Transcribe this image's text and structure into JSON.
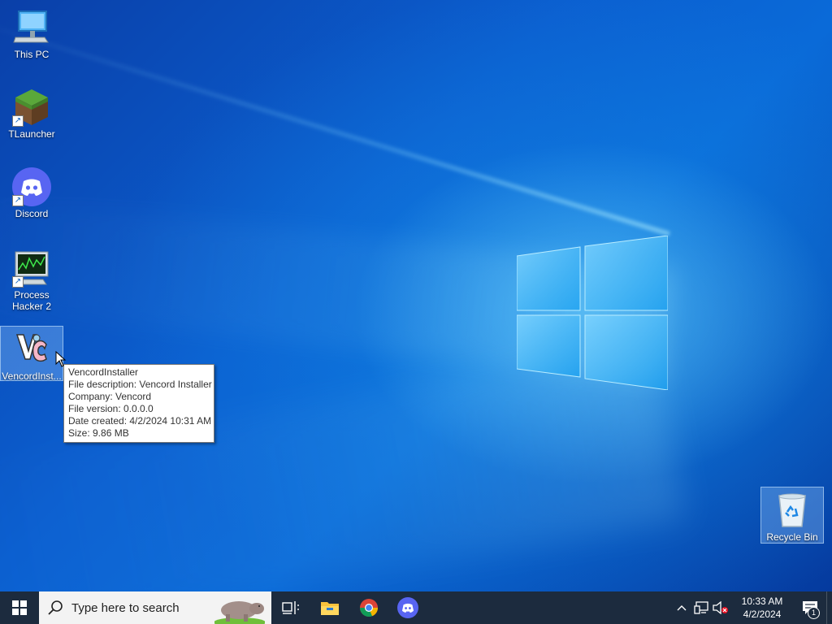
{
  "desktop": {
    "icons": [
      {
        "label": "This PC",
        "icon": "computer-icon",
        "shortcut": false
      },
      {
        "label": "TLauncher",
        "icon": "minecraft-grass-block-icon",
        "shortcut": true
      },
      {
        "label": "Discord",
        "icon": "discord-icon",
        "shortcut": true
      },
      {
        "label": "Process\nHacker 2",
        "icon": "process-hacker-icon",
        "shortcut": true
      },
      {
        "label": "VencordInst...",
        "icon": "vencord-installer-icon",
        "shortcut": false,
        "selected": true
      }
    ],
    "recycle_bin": {
      "label": "Recycle Bin",
      "icon": "recycle-bin-icon"
    }
  },
  "tooltip": {
    "name": "VencordInstaller",
    "description": "File description: Vencord Installer",
    "company": "Company: Vencord",
    "version": "File version: 0.0.0.0",
    "date_created": "Date created: 4/2/2024 10:31 AM",
    "size": "Size: 9.86 MB"
  },
  "taskbar": {
    "search_placeholder": "Type here to search",
    "pinned": [
      "task-view-icon",
      "file-explorer-icon",
      "chrome-icon",
      "discord-icon"
    ],
    "clock": {
      "time": "10:33 AM",
      "date": "4/2/2024"
    },
    "notifications_count": "1"
  },
  "colors": {
    "taskbar": "#1c2b3e",
    "desktop_blue": "#0b5fd0",
    "discord": "#5865f2"
  }
}
